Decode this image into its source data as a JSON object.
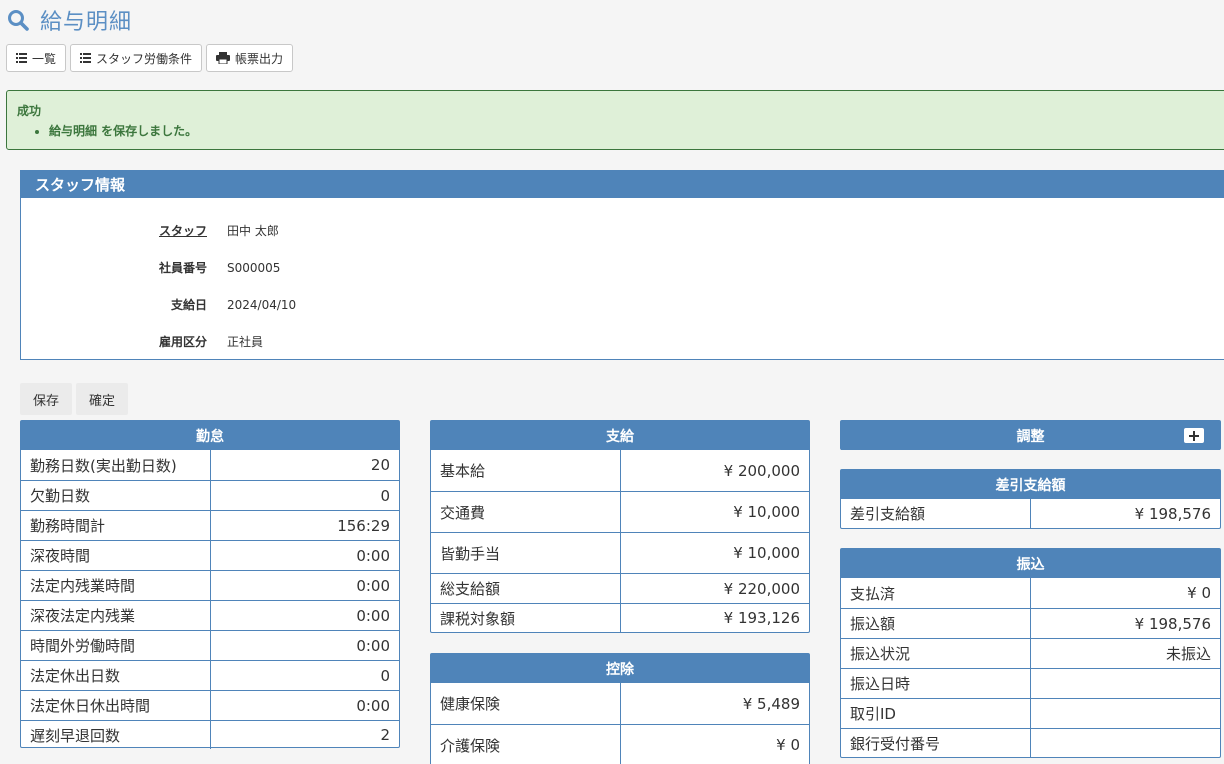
{
  "page": {
    "title": "給与明細"
  },
  "toolbar": {
    "list_label": "一覧",
    "conditions_label": "スタッフ労働条件",
    "print_label": "帳票出力"
  },
  "alert": {
    "title": "成功",
    "message": "給与明細 を保存しました。"
  },
  "staff": {
    "heading": "スタッフ情報",
    "rows": [
      {
        "label": "スタッフ",
        "value": "田中 太郎"
      },
      {
        "label": "社員番号",
        "value": "S000005"
      },
      {
        "label": "支給日",
        "value": "2024/04/10"
      },
      {
        "label": "雇用区分",
        "value": "正社員"
      }
    ]
  },
  "actions": {
    "save_label": "保存",
    "confirm_label": "確定"
  },
  "attendance": {
    "heading": "勤怠",
    "rows": [
      {
        "label": "勤務日数(実出勤日数)",
        "value": "20"
      },
      {
        "label": "欠勤日数",
        "value": "0"
      },
      {
        "label": "勤務時間計",
        "value": "156:29"
      },
      {
        "label": "深夜時間",
        "value": "0:00"
      },
      {
        "label": "法定内残業時間",
        "value": "0:00"
      },
      {
        "label": "深夜法定内残業",
        "value": "0:00"
      },
      {
        "label": "時間外労働時間",
        "value": "0:00"
      },
      {
        "label": "法定休出日数",
        "value": "0"
      },
      {
        "label": "法定休日休出時間",
        "value": "0:00"
      },
      {
        "label": "遅刻早退回数",
        "value": "2"
      }
    ]
  },
  "payment": {
    "heading": "支給",
    "rows": [
      {
        "label": "基本給",
        "value": "¥ 200,000"
      },
      {
        "label": "交通費",
        "value": "¥ 10,000"
      },
      {
        "label": "皆勤手当",
        "value": "¥ 10,000"
      },
      {
        "label": "総支給額",
        "value": "¥ 220,000"
      },
      {
        "label": "課税対象額",
        "value": "¥ 193,126"
      }
    ]
  },
  "deduction": {
    "heading": "控除",
    "rows": [
      {
        "label": "健康保険",
        "value": "¥ 5,489"
      },
      {
        "label": "介護保険",
        "value": "¥ 0"
      }
    ]
  },
  "adjustment": {
    "heading": "調整"
  },
  "net_pay": {
    "heading": "差引支給額",
    "rows": [
      {
        "label": "差引支給額",
        "value": "¥ 198,576"
      }
    ]
  },
  "transfer": {
    "heading": "振込",
    "rows": [
      {
        "label": "支払済",
        "value": "¥ 0"
      },
      {
        "label": "振込額",
        "value": "¥ 198,576"
      },
      {
        "label": "振込状況",
        "value": "未振込"
      },
      {
        "label": "振込日時",
        "value": ""
      },
      {
        "label": "取引ID",
        "value": ""
      },
      {
        "label": "銀行受付番号",
        "value": ""
      }
    ]
  },
  "colors": {
    "primary": "#4f84b9",
    "title": "#5b8fc4",
    "success_bg": "#dff0d8",
    "success_text": "#3c763d"
  }
}
